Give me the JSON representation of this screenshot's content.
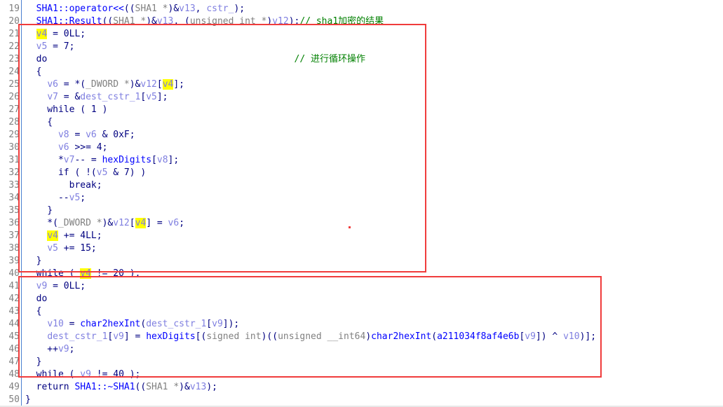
{
  "view": "pseudocode",
  "lines": [
    {
      "n": "19",
      "segs": [
        [
          "k",
          "  "
        ],
        [
          "f",
          "SHA1::operator<<"
        ],
        [
          "k",
          "(("
        ],
        [
          "g",
          "SHA1 *"
        ],
        [
          "k",
          ")&"
        ],
        [
          "v",
          "v13"
        ],
        [
          "k",
          ", "
        ],
        [
          "v",
          "cstr_"
        ],
        [
          "k",
          ");"
        ]
      ]
    },
    {
      "n": "20",
      "segs": [
        [
          "k",
          "  "
        ],
        [
          "f",
          "SHA1::Result"
        ],
        [
          "k",
          "(("
        ],
        [
          "g",
          "SHA1 *"
        ],
        [
          "k",
          ")&"
        ],
        [
          "v",
          "v13"
        ],
        [
          "k",
          ", ("
        ],
        [
          "g",
          "unsigned int *"
        ],
        [
          "k",
          ")"
        ],
        [
          "v",
          "v12"
        ],
        [
          "k",
          ");"
        ],
        [
          "c",
          "// sha1加密的结果"
        ]
      ]
    },
    {
      "n": "21",
      "segs": [
        [
          "k",
          "  "
        ],
        [
          "h",
          "v4"
        ],
        [
          "k",
          " = 0LL;"
        ]
      ]
    },
    {
      "n": "22",
      "segs": [
        [
          "k",
          "  "
        ],
        [
          "v",
          "v5"
        ],
        [
          "k",
          " = 7;"
        ]
      ]
    },
    {
      "n": "23",
      "segs": [
        [
          "k",
          "  do                                             "
        ],
        [
          "c",
          "// 进行循环操作"
        ]
      ]
    },
    {
      "n": "24",
      "segs": [
        [
          "k",
          "  {"
        ]
      ]
    },
    {
      "n": "25",
      "segs": [
        [
          "k",
          "    "
        ],
        [
          "v",
          "v6"
        ],
        [
          "k",
          " = *("
        ],
        [
          "g",
          "_DWORD *"
        ],
        [
          "k",
          ")&"
        ],
        [
          "v",
          "v12"
        ],
        [
          "k",
          "["
        ],
        [
          "h",
          "v4"
        ],
        [
          "k",
          "];"
        ]
      ]
    },
    {
      "n": "26",
      "segs": [
        [
          "k",
          "    "
        ],
        [
          "v",
          "v7"
        ],
        [
          "k",
          " = &"
        ],
        [
          "v",
          "dest_cstr_1"
        ],
        [
          "k",
          "["
        ],
        [
          "v",
          "v5"
        ],
        [
          "k",
          "];"
        ]
      ]
    },
    {
      "n": "27",
      "segs": [
        [
          "k",
          "    while ( 1 )"
        ]
      ]
    },
    {
      "n": "28",
      "segs": [
        [
          "k",
          "    {"
        ]
      ]
    },
    {
      "n": "29",
      "segs": [
        [
          "k",
          "      "
        ],
        [
          "v",
          "v8"
        ],
        [
          "k",
          " = "
        ],
        [
          "v",
          "v6"
        ],
        [
          "k",
          " & 0xF;"
        ]
      ]
    },
    {
      "n": "30",
      "segs": [
        [
          "k",
          "      "
        ],
        [
          "v",
          "v6"
        ],
        [
          "k",
          " >>= 4;"
        ]
      ]
    },
    {
      "n": "31",
      "segs": [
        [
          "k",
          "      *"
        ],
        [
          "v",
          "v7"
        ],
        [
          "k",
          "-- = "
        ],
        [
          "f",
          "hexDigits"
        ],
        [
          "k",
          "["
        ],
        [
          "v",
          "v8"
        ],
        [
          "k",
          "];"
        ]
      ]
    },
    {
      "n": "32",
      "segs": [
        [
          "k",
          "      if ( !("
        ],
        [
          "v",
          "v5"
        ],
        [
          "k",
          " & 7) )"
        ]
      ]
    },
    {
      "n": "33",
      "segs": [
        [
          "k",
          "        break;"
        ]
      ]
    },
    {
      "n": "34",
      "segs": [
        [
          "k",
          "      --"
        ],
        [
          "v",
          "v5"
        ],
        [
          "k",
          ";"
        ]
      ]
    },
    {
      "n": "35",
      "segs": [
        [
          "k",
          "    }"
        ]
      ]
    },
    {
      "n": "36",
      "segs": [
        [
          "k",
          "    *("
        ],
        [
          "g",
          "_DWORD *"
        ],
        [
          "k",
          ")&"
        ],
        [
          "v",
          "v12"
        ],
        [
          "k",
          "["
        ],
        [
          "h",
          "v4"
        ],
        [
          "k",
          "] = "
        ],
        [
          "v",
          "v6"
        ],
        [
          "k",
          ";"
        ]
      ]
    },
    {
      "n": "37",
      "segs": [
        [
          "k",
          "    "
        ],
        [
          "h",
          "v4"
        ],
        [
          "k",
          " += 4LL;"
        ]
      ]
    },
    {
      "n": "38",
      "segs": [
        [
          "k",
          "    "
        ],
        [
          "v",
          "v5"
        ],
        [
          "k",
          " += 15;"
        ]
      ]
    },
    {
      "n": "39",
      "segs": [
        [
          "k",
          "  }"
        ]
      ]
    },
    {
      "n": "40",
      "segs": [
        [
          "k",
          "  while ( "
        ],
        [
          "h",
          "v4"
        ],
        [
          "k",
          " != 20 );"
        ]
      ]
    },
    {
      "n": "41",
      "segs": [
        [
          "k",
          "  "
        ],
        [
          "v",
          "v9"
        ],
        [
          "k",
          " = 0LL;"
        ]
      ]
    },
    {
      "n": "42",
      "segs": [
        [
          "k",
          "  do"
        ]
      ]
    },
    {
      "n": "43",
      "segs": [
        [
          "k",
          "  {"
        ]
      ]
    },
    {
      "n": "44",
      "segs": [
        [
          "k",
          "    "
        ],
        [
          "v",
          "v10"
        ],
        [
          "k",
          " = "
        ],
        [
          "f",
          "char2hexInt"
        ],
        [
          "k",
          "("
        ],
        [
          "v",
          "dest_cstr_1"
        ],
        [
          "k",
          "["
        ],
        [
          "v",
          "v9"
        ],
        [
          "k",
          "]);"
        ]
      ]
    },
    {
      "n": "45",
      "segs": [
        [
          "k",
          "    "
        ],
        [
          "v",
          "dest_cstr_1"
        ],
        [
          "k",
          "["
        ],
        [
          "v",
          "v9"
        ],
        [
          "k",
          "] = "
        ],
        [
          "f",
          "hexDigits"
        ],
        [
          "k",
          "[("
        ],
        [
          "g",
          "signed int"
        ],
        [
          "k",
          ")(("
        ],
        [
          "g",
          "unsigned __int64"
        ],
        [
          "k",
          ")"
        ],
        [
          "f",
          "char2hexInt"
        ],
        [
          "k",
          "("
        ],
        [
          "f",
          "a211034f8af4e6b"
        ],
        [
          "k",
          "["
        ],
        [
          "v",
          "v9"
        ],
        [
          "k",
          "]) ^ "
        ],
        [
          "v",
          "v10"
        ],
        [
          "k",
          ")];"
        ]
      ]
    },
    {
      "n": "46",
      "segs": [
        [
          "k",
          "    ++"
        ],
        [
          "v",
          "v9"
        ],
        [
          "k",
          ";"
        ]
      ]
    },
    {
      "n": "47",
      "segs": [
        [
          "k",
          "  }"
        ]
      ]
    },
    {
      "n": "48",
      "segs": [
        [
          "k",
          "  while ( "
        ],
        [
          "v",
          "v9"
        ],
        [
          "k",
          " != 40 );"
        ]
      ]
    },
    {
      "n": "49",
      "segs": [
        [
          "k",
          "  return "
        ],
        [
          "f",
          "SHA1::~SHA1"
        ],
        [
          "k",
          "(("
        ],
        [
          "g",
          "SHA1 *"
        ],
        [
          "k",
          ")&"
        ],
        [
          "v",
          "v13"
        ],
        [
          "k",
          ");"
        ]
      ]
    },
    {
      "n": "50",
      "segs": [
        [
          "k",
          "}"
        ]
      ]
    }
  ],
  "colors": {
    "annotation_box": "#f03c3c",
    "highlight": "#ffff00"
  }
}
